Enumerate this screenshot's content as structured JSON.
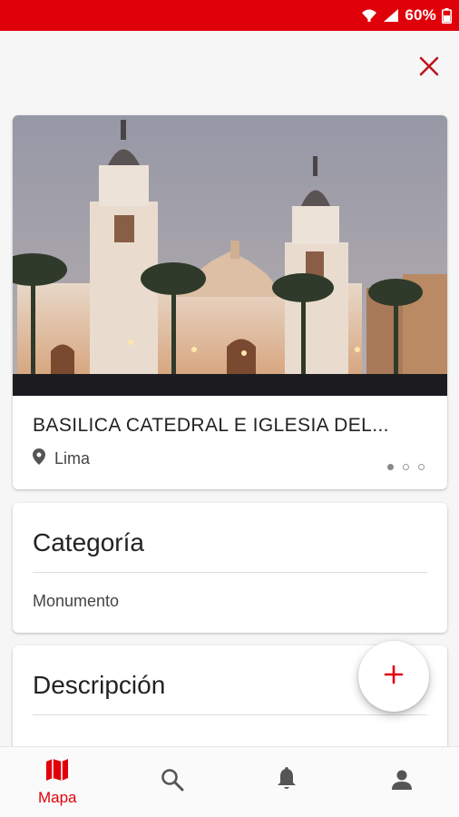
{
  "status_bar": {
    "battery_percent": "60%",
    "icons": [
      "wifi-icon",
      "signal-icon",
      "battery-icon"
    ],
    "color": "#e0000a"
  },
  "header": {
    "close_icon": "close-icon"
  },
  "place": {
    "title": "BASILICA CATEDRAL E IGLESIA DEL...",
    "location": "Lima",
    "location_icon": "location-pin-icon",
    "carousel_count": 3,
    "carousel_active": 1
  },
  "category": {
    "heading": "Categoría",
    "value": "Monumento"
  },
  "description": {
    "heading": "Descripción"
  },
  "fab": {
    "icon": "plus-icon"
  },
  "bottom_nav": {
    "items": [
      {
        "label": "Mapa",
        "icon": "map-icon",
        "active": true
      },
      {
        "label": "",
        "icon": "search-icon",
        "active": false
      },
      {
        "label": "",
        "icon": "bell-icon",
        "active": false
      },
      {
        "label": "",
        "icon": "person-icon",
        "active": false
      }
    ]
  },
  "colors": {
    "accent": "#e0000a",
    "inactive_icon": "#555555"
  }
}
